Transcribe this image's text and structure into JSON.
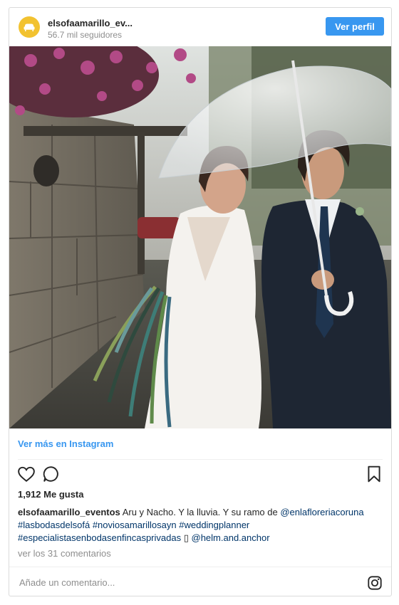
{
  "header": {
    "username": "elsofaamarillo_ev...",
    "followers": "56.7 mil seguidores",
    "view_profile": "Ver perfil",
    "avatar_icon": "sofa-icon"
  },
  "post": {
    "view_more": "Ver más en Instagram",
    "likes": "1,912 Me gusta",
    "caption_user": "elsofaamarillo_eventos",
    "caption_text": "Aru y Nacho. Y la lluvia. Y su ramo de",
    "mention_1": "@enlafloreriacoruna",
    "hashtag_1": "#lasbodasdelsofá",
    "hashtag_2": "#noviosamarillosayn",
    "hashtag_3": "#weddingplanner",
    "hashtag_4": "#especialistasenbodasenfincasprivadas",
    "emoji_box": "▯",
    "mention_2": "@helm.and.anchor",
    "view_comments": "ver los 31 comentarios",
    "comment_placeholder": "Añade un comentario..."
  },
  "icons": {
    "like": "heart-icon",
    "comment": "comment-icon",
    "save": "bookmark-icon",
    "instagram": "instagram-icon"
  },
  "colors": {
    "accent": "#3897f0",
    "link": "#003569",
    "muted": "#8e8e8e",
    "avatar": "#f2c230"
  }
}
